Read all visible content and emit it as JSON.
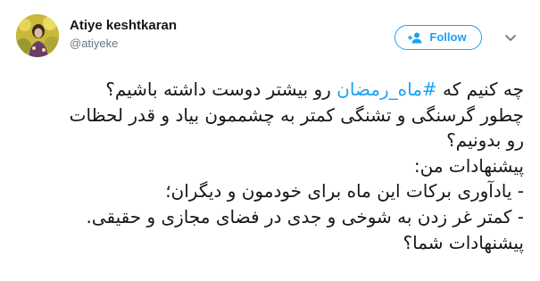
{
  "tweet": {
    "author": {
      "display_name": "Atiye keshtkaran",
      "handle": "@atiyeke",
      "avatar_icon": "profile-photo"
    },
    "follow_label": "Follow",
    "menu_icon": "chevron-down-icon",
    "text": {
      "line1_before": "چه کنیم که ",
      "hashtag": "#ماه_رمضان",
      "line1_after": " رو بیشتر دوست داشته باشیم؟",
      "line2": "چطور گرسنگی و تشنگی کمتر به چشممون بیاد و قدر لحظات",
      "line3": "رو بدونیم؟",
      "line4": "پیشنهادات من:",
      "line5": "- یادآوری برکات این ماه برای خودمون و دیگران؛",
      "line6": "- کمتر غر زدن به شوخی و جدی در فضای مجازی و حقیقی.",
      "line7": "پیشنهادات شما؟"
    }
  },
  "colors": {
    "accent": "#1da1f2",
    "text": "#14171a",
    "secondary": "#657786"
  }
}
